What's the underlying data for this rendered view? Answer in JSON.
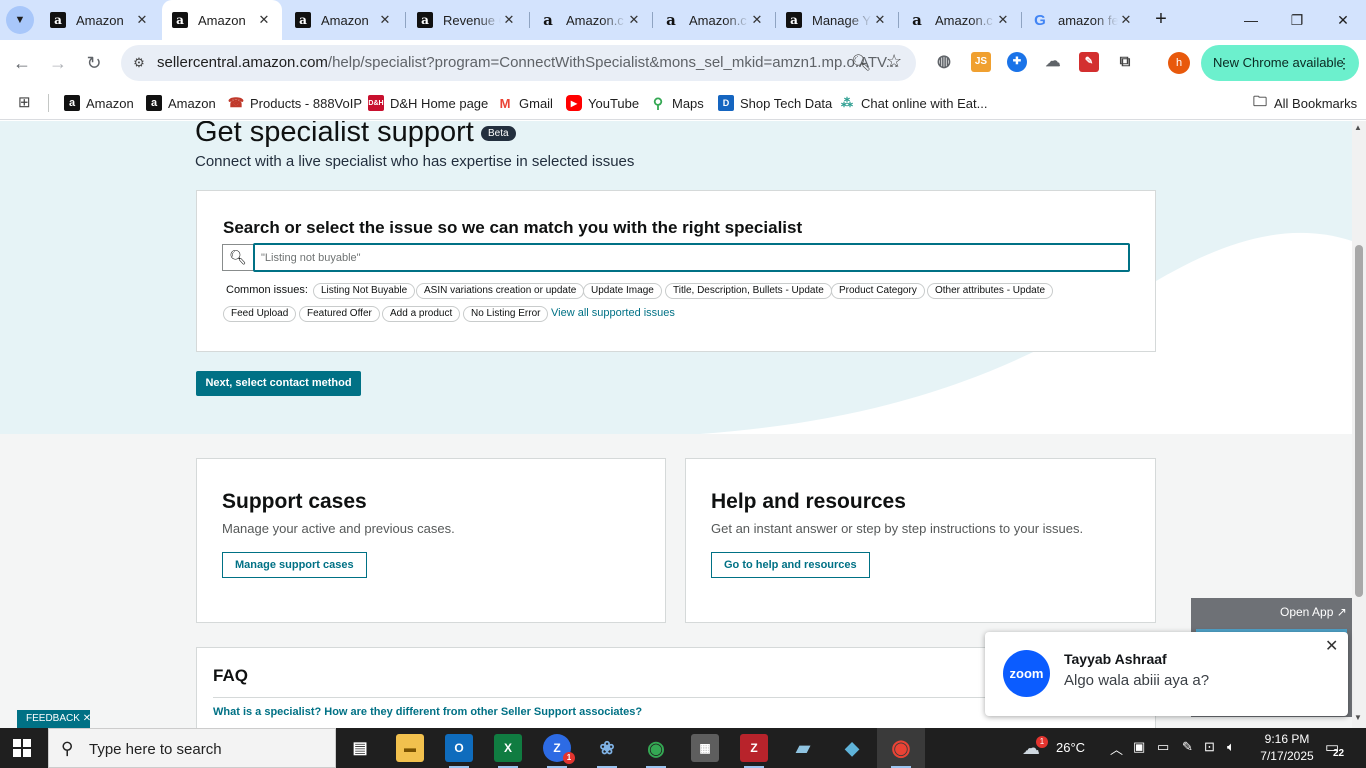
{
  "tabs": [
    {
      "title": "Amazon",
      "favicon": "amazon-icon",
      "active": false
    },
    {
      "title": "Amazon",
      "favicon": "amazon-icon",
      "active": true
    },
    {
      "title": "Amazon",
      "favicon": "amazon-icon",
      "active": false
    },
    {
      "title": "Revenue C",
      "favicon": "amazon-icon",
      "active": false
    },
    {
      "title": "Amazon.c",
      "favicon": "amazon-smile-icon",
      "active": false
    },
    {
      "title": "Amazon.c",
      "favicon": "amazon-smile-icon",
      "active": false
    },
    {
      "title": "Manage Y",
      "favicon": "amazon-icon",
      "active": false
    },
    {
      "title": "Amazon.c",
      "favicon": "amazon-smile-icon",
      "active": false
    },
    {
      "title": "amazon fe",
      "favicon": "google-icon",
      "active": false
    }
  ],
  "address_bar": {
    "host": "sellercentral.amazon.com",
    "path": "/help/specialist?program=ConnectWithSpecialist&mons_sel_mkid=amzn1.mp.o.ATV..."
  },
  "update_button": "New Chrome available",
  "profile_initial": "h",
  "bookmarks": [
    {
      "label": "Amazon",
      "icon": "amazon-icon"
    },
    {
      "label": "Amazon",
      "icon": "amazon-icon"
    },
    {
      "label": "Products - 888VoIP",
      "icon": "voip-icon"
    },
    {
      "label": "D&H Home page",
      "icon": "dh-icon"
    },
    {
      "label": "Gmail",
      "icon": "gmail-icon"
    },
    {
      "label": "YouTube",
      "icon": "youtube-icon"
    },
    {
      "label": "Maps",
      "icon": "maps-icon"
    },
    {
      "label": "Shop Tech Data",
      "icon": "techdata-icon"
    },
    {
      "label": "Chat online with Eat...",
      "icon": "chat-icon"
    }
  ],
  "all_bookmarks": "All Bookmarks",
  "page": {
    "title": "Get specialist support",
    "beta": "Beta",
    "subtitle": "Connect with a live specialist who has expertise in selected issues",
    "search_heading": "Search or select the issue so we can match you with the right specialist",
    "search_placeholder": "\"Listing not buyable\"",
    "common_issues_label": "Common issues:",
    "common_issues": [
      "Listing Not Buyable",
      "ASIN variations creation or update",
      "Update Image",
      "Title, Description, Bullets - Update",
      "Product Category",
      "Other attributes - Update",
      "Feed Upload",
      "Featured Offer",
      "Add a product",
      "No Listing Error"
    ],
    "view_all": "View all supported issues",
    "next_button": "Next, select contact method",
    "support_cases": {
      "title": "Support cases",
      "description": "Manage your active and previous cases.",
      "button": "Manage support cases"
    },
    "help_resources": {
      "title": "Help and resources",
      "description": "Get an instant answer or step by step instructions to your issues.",
      "button": "Go to help and resources"
    },
    "faq": {
      "title": "FAQ",
      "q1": "What is a specialist? How are they different from other Seller Support associates?"
    },
    "feedback": "FEEDBACK"
  },
  "zoom_notification": {
    "open_app": "Open App",
    "logo_text": "zoom",
    "sender": "Tayyab Ashraaf",
    "message": "Algo wala abiii aya a?"
  },
  "taskbar": {
    "search_placeholder": "Type here to search",
    "temperature": "26°C",
    "weather_badge": "1",
    "time": "9:16 PM",
    "date": "7/17/2025",
    "notification_count": "22",
    "zoom_badge": "1"
  },
  "colors": {
    "teal": "#007185",
    "hero_bg": "#e6f3f6",
    "chrome_tab_strip": "#d3e3fd",
    "update_button": "#6cf0cd"
  }
}
